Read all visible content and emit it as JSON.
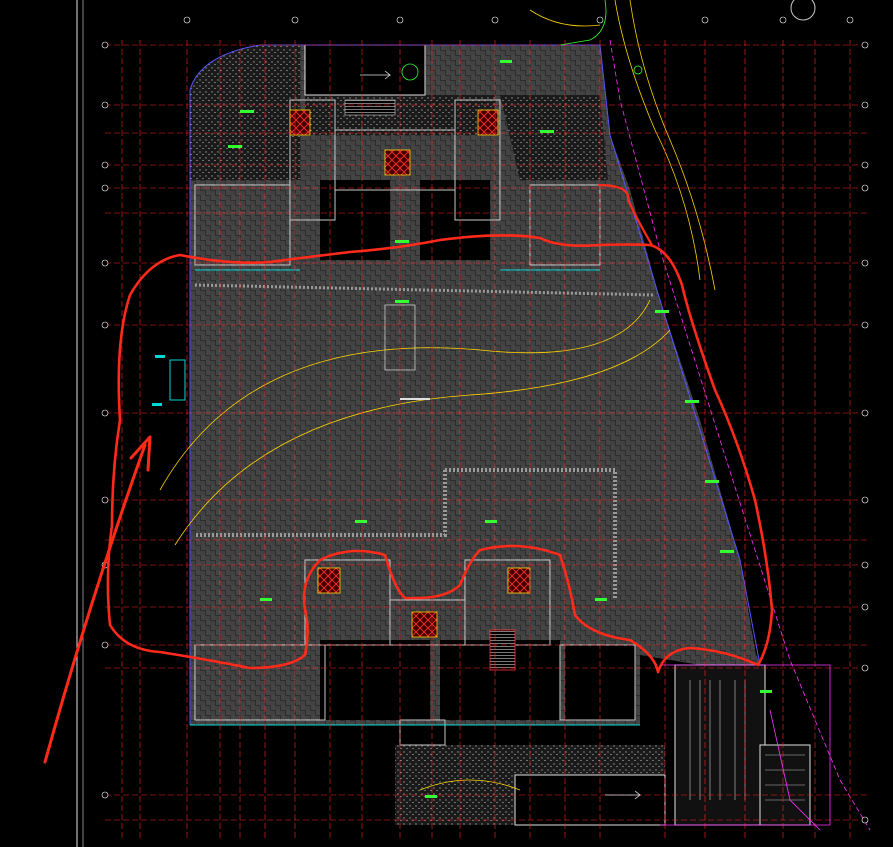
{
  "drawing": {
    "background": "#000000",
    "colors": {
      "grid": "#ff2222",
      "wall": "#9a9a9a",
      "boundary": "#5555ff",
      "yellow": "#ffd400",
      "green": "#33ff33",
      "magenta": "#ff33ff",
      "cyan": "#00d8d8",
      "markup": "#ff2a1a"
    }
  },
  "annotation": {
    "closed_loop_markup": "red-freehand-outline",
    "arrow_markup": "red-arrow"
  }
}
